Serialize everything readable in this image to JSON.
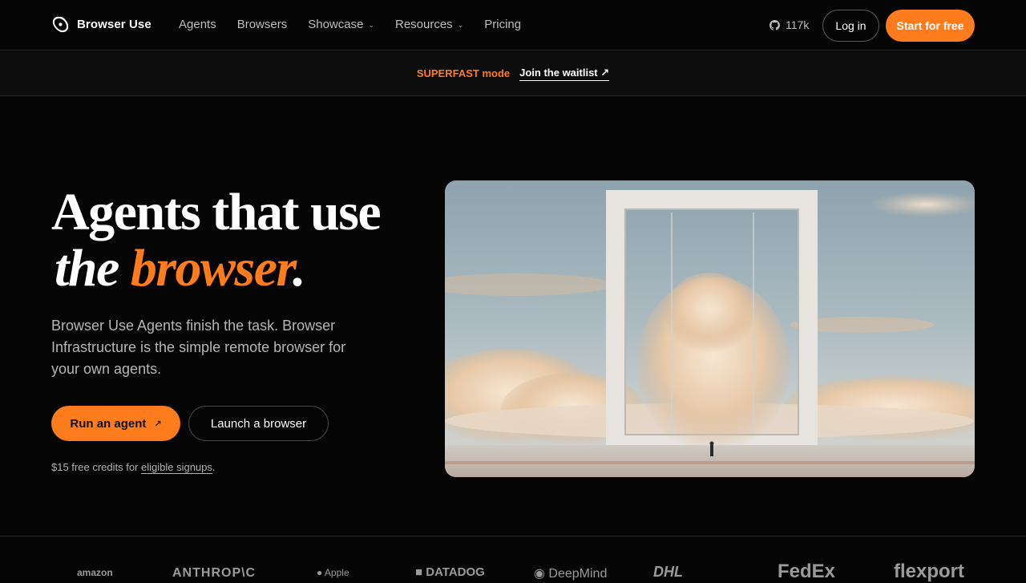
{
  "brand": {
    "name": "Browser Use",
    "icon": "brand-logo-icon"
  },
  "nav": {
    "links": [
      {
        "label": "Agents"
      },
      {
        "label": "Browsers"
      },
      {
        "label": "Showcase"
      },
      {
        "label": "Resources"
      },
      {
        "label": "Pricing"
      }
    ],
    "github_stars": "117k",
    "login_label": "Log in",
    "start_label": "Start for free"
  },
  "banner": {
    "mode": "SUPERFAST mode",
    "link": "Join the waitlist ↗"
  },
  "hero": {
    "title_line1": "Agents that use",
    "title_line2_a": "the ",
    "title_line2_b": "browser",
    "title_line2_c": ".",
    "subtitle": "Browser Use Agents finish the task. Browser Infrastructure is the simple remote browser for your own agents.",
    "run_label": "Run an agent",
    "run_arrow": "↗",
    "launch_label": "Launch a browser",
    "credits_prefix": "$15 free credits for ",
    "credits_link": "eligible signups",
    "credits_suffix": "."
  },
  "logos": [
    "amazon",
    "ANTHROP\\C",
    "Apple",
    "DATADOG",
    "DeepMind",
    "DHL",
    "FedEx",
    "flexport"
  ],
  "colors": {
    "accent": "#fe7c1c",
    "background": "#050505",
    "border": "#2a2a2a"
  }
}
